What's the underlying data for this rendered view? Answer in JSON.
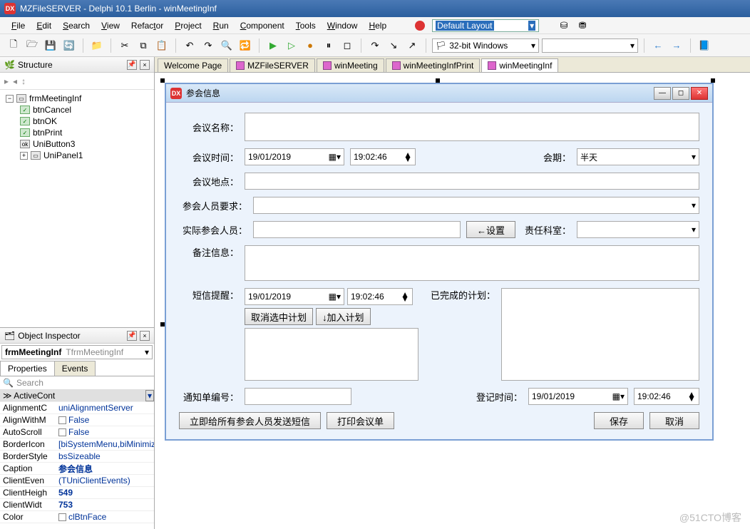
{
  "title": "MZFileSERVER - Delphi 10.1 Berlin - winMeetingInf",
  "menu": [
    "File",
    "Edit",
    "Search",
    "View",
    "Refactor",
    "Project",
    "Run",
    "Component",
    "Tools",
    "Window",
    "Help"
  ],
  "layout": "Default Layout",
  "platform": "32-bit Windows",
  "structure": {
    "title": "Structure",
    "root": "frmMeetingInf",
    "items": [
      "btnCancel",
      "btnOK",
      "btnPrint",
      "UniButton3",
      "UniPanel1"
    ]
  },
  "inspector": {
    "title": "Object Inspector",
    "obj": "frmMeetingInf",
    "cls": "TfrmMeetingInf",
    "tabs": [
      "Properties",
      "Events"
    ],
    "search": "Search",
    "header": "ActiveCont",
    "props": [
      {
        "k": "AlignmentC",
        "v": "uniAlignmentServer"
      },
      {
        "k": "AlignWithM",
        "v": "False",
        "chk": true
      },
      {
        "k": "AutoScroll",
        "v": "False",
        "chk": true
      },
      {
        "k": "BorderIcon",
        "v": "[biSystemMenu,biMinimize,b"
      },
      {
        "k": "BorderStyle",
        "v": "bsSizeable"
      },
      {
        "k": "Caption",
        "v": "参会信息",
        "bold": true
      },
      {
        "k": "ClientEven",
        "v": "(TUniClientEvents)"
      },
      {
        "k": "ClientHeigh",
        "v": "549",
        "bold": true
      },
      {
        "k": "ClientWidt",
        "v": "753",
        "bold": true
      },
      {
        "k": "Color",
        "v": "clBtnFace",
        "chk": true
      }
    ]
  },
  "docTabs": [
    "Welcome Page",
    "MZFileSERVER",
    "winMeeting",
    "winMeetingInfPrint",
    "winMeetingInf"
  ],
  "form": {
    "title": "参会信息",
    "labels": {
      "name": "会议名称：",
      "time": "会议时间：",
      "period": "会期：",
      "periodVal": "半天",
      "place": "会议地点：",
      "req": "参会人员要求：",
      "actual": "实际参会人员：",
      "setBtn": "←设置",
      "dept": "责任科室：",
      "remark": "备注信息：",
      "sms": "短信提醒：",
      "done": "已完成的计划：",
      "cancelPlan": "取消选中计划",
      "addPlan": "↓加入计划",
      "notice": "通知单编号：",
      "regtime": "登记时间：",
      "sendSms": "立即给所有参会人员发送短信",
      "print": "打印会议单",
      "save": "保存",
      "cancel": "取消"
    },
    "date": "19/01/2019",
    "timeVal": "19:02:46"
  },
  "watermark": "@51CTO博客"
}
